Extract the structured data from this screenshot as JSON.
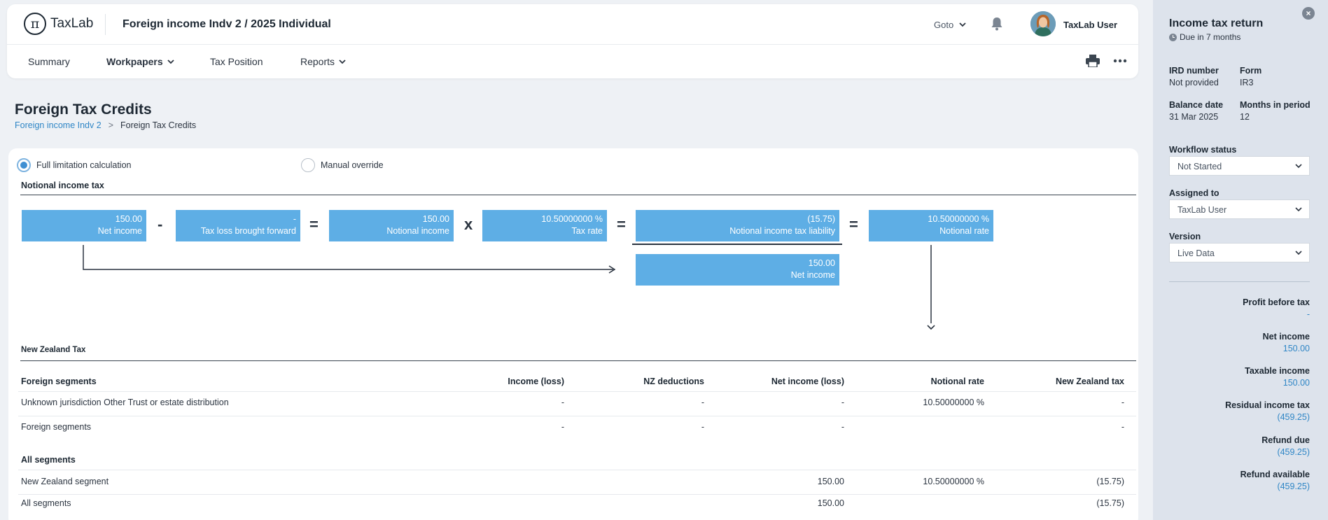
{
  "header": {
    "logo_text": "TaxLab",
    "logo_symbol": "π",
    "client_title": "Foreign income Indv 2 / 2025 Individual",
    "goto_label": "Goto",
    "user_name": "TaxLab User"
  },
  "nav": {
    "summary": "Summary",
    "workpapers": "Workpapers",
    "tax_position": "Tax Position",
    "reports": "Reports"
  },
  "page": {
    "title": "Foreign Tax Credits",
    "breadcrumb_link": "Foreign income Indv 2",
    "breadcrumb_sep": ">",
    "breadcrumb_current": "Foreign Tax Credits"
  },
  "options": {
    "full_limitation": "Full limitation calculation",
    "manual_override": "Manual override",
    "selected": "full_limitation"
  },
  "notional": {
    "heading": "Notional income tax",
    "net_income": {
      "value": "150.00",
      "label": "Net income"
    },
    "op1": "-",
    "tax_loss": {
      "value": "-",
      "label": "Tax loss brought forward"
    },
    "op2": "=",
    "notional_income": {
      "value": "150.00",
      "label": "Notional income"
    },
    "op3": "x",
    "tax_rate": {
      "value": "10.50000000 %",
      "label": "Tax rate"
    },
    "op4": "=",
    "liability": {
      "value": "(15.75)",
      "label": "Notional income tax liability"
    },
    "denominator": {
      "value": "150.00",
      "label": "Net income"
    },
    "op5": "=",
    "notional_rate": {
      "value": "10.50000000 %",
      "label": "Notional rate"
    }
  },
  "nz_tax": {
    "heading": "New Zealand Tax",
    "columns": [
      "Foreign segments",
      "Income (loss)",
      "NZ deductions",
      "Net income (loss)",
      "Notional rate",
      "New Zealand tax"
    ],
    "foreign_rows": [
      [
        "Unknown jurisdiction Other Trust or estate distribution",
        "-",
        "-",
        "-",
        "10.50000000 %",
        "-"
      ],
      [
        "Foreign segments",
        "-",
        "-",
        "-",
        "",
        "-"
      ]
    ],
    "all_heading": "All segments",
    "all_rows": [
      [
        "New Zealand segment",
        "",
        "",
        "150.00",
        "10.50000000 %",
        "(15.75)"
      ],
      [
        "All segments",
        "",
        "",
        "150.00",
        "",
        "(15.75)"
      ]
    ]
  },
  "panel": {
    "title": "Income tax return",
    "due": "Due in 7 months",
    "ird_label": "IRD number",
    "ird_value": "Not provided",
    "form_label": "Form",
    "form_value": "IR3",
    "balance_label": "Balance date",
    "balance_value": "31 Mar 2025",
    "months_label": "Months in period",
    "months_value": "12",
    "workflow_label": "Workflow status",
    "workflow_value": "Not Started",
    "assigned_label": "Assigned to",
    "assigned_value": "TaxLab User",
    "version_label": "Version",
    "version_value": "Live Data",
    "summary": [
      {
        "label": "Profit before tax",
        "value": "-"
      },
      {
        "label": "Net income",
        "value": "150.00"
      },
      {
        "label": "Taxable income",
        "value": "150.00"
      },
      {
        "label": "Residual income tax",
        "value": "(459.25)"
      },
      {
        "label": "Refund due",
        "value": "(459.25)"
      },
      {
        "label": "Refund available",
        "value": "(459.25)"
      }
    ]
  }
}
